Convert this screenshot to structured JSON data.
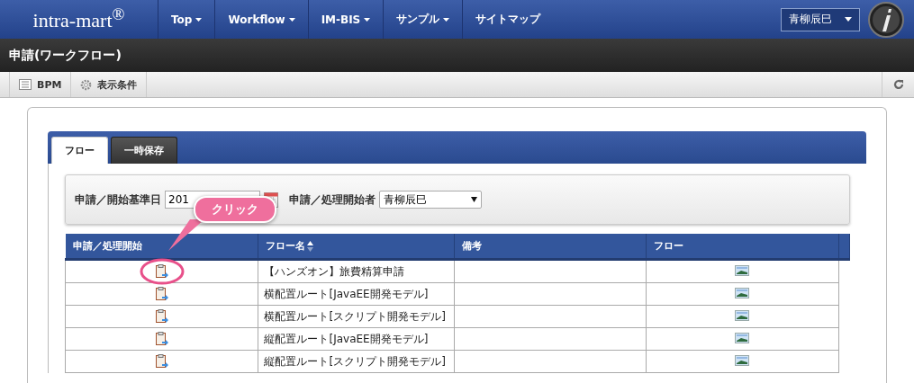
{
  "header": {
    "logo": "intra-mart$^{®}$",
    "nav": [
      {
        "label": "Top",
        "has_menu": true
      },
      {
        "label": "Workflow",
        "has_menu": true
      },
      {
        "label": "IM-BIS",
        "has_menu": true
      },
      {
        "label": "サンプル",
        "has_menu": true
      },
      {
        "label": "サイトマップ",
        "has_menu": false
      }
    ],
    "user": "青柳辰巳"
  },
  "page_title": "申請(ワークフロー)",
  "toolbar": [
    {
      "label": "BPM",
      "kind": "list"
    },
    {
      "label": "表示条件",
      "kind": "gear"
    }
  ],
  "tabs": [
    {
      "label": "フロー",
      "selected": true
    },
    {
      "label": "一時保存",
      "selected": false
    }
  ],
  "filter": {
    "date_label": "申請／開始基準日",
    "date_value": "201",
    "applicant_label": "申請／処理開始者",
    "applicant_value": "青柳辰巳"
  },
  "table": {
    "columns": [
      {
        "label": "申請／処理開始",
        "sortable": false
      },
      {
        "label": "フロー名",
        "sortable": true
      },
      {
        "label": "備考",
        "sortable": false
      },
      {
        "label": "フロー",
        "sortable": false
      }
    ],
    "rows": [
      {
        "flow_name": "【ハンズオン】旅費精算申請",
        "highlighted": true
      },
      {
        "flow_name": "横配置ルート[JavaEE開発モデル]",
        "highlighted": false
      },
      {
        "flow_name": "横配置ルート[スクリプト開発モデル]",
        "highlighted": false
      },
      {
        "flow_name": "縦配置ルート[JavaEE開発モデル]",
        "highlighted": false
      },
      {
        "flow_name": "縦配置ルート[スクリプト開発モデル]",
        "highlighted": false
      }
    ]
  },
  "callout": {
    "text": "クリック"
  }
}
